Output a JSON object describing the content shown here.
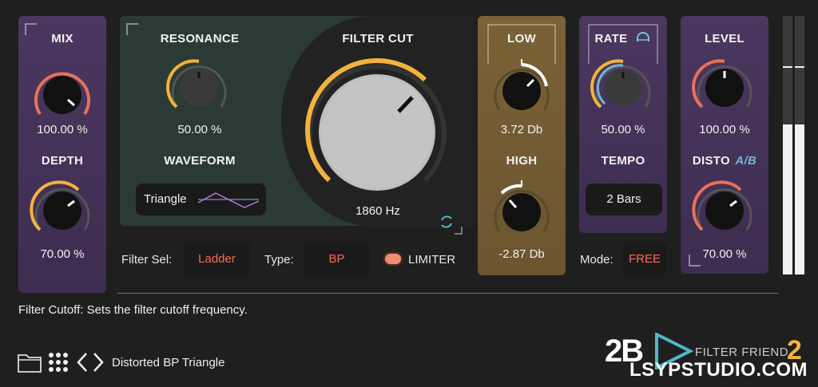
{
  "mix": {
    "label": "MIX",
    "value": "100.00 %",
    "level": 1.0
  },
  "depth": {
    "label": "DEPTH",
    "value": "70.00 %",
    "level": 0.7
  },
  "resonance": {
    "label": "RESONANCE",
    "value": "50.00 %",
    "level": 0.5
  },
  "waveform": {
    "label": "WAVEFORM",
    "selected": "Triangle"
  },
  "filter_cut": {
    "label": "FILTER CUT",
    "value": "1860 Hz"
  },
  "low": {
    "label": "LOW",
    "value": "3.72 Db"
  },
  "high": {
    "label": "HIGH",
    "value": "-2.87 Db"
  },
  "rate": {
    "label": "RATE",
    "value": "50.00 %"
  },
  "tempo": {
    "label": "TEMPO",
    "value": "2 Bars"
  },
  "level": {
    "label": "LEVEL",
    "value": "100.00 %"
  },
  "disto": {
    "label": "DISTO",
    "ab": "A/B",
    "value": "70.00 %"
  },
  "filter_bar": {
    "filter_sel_label": "Filter Sel:",
    "filter_sel_value": "Ladder",
    "type_label": "Type:",
    "type_value": "BP",
    "limiter_label": "LIMITER",
    "mode_label": "Mode:",
    "mode_value": "FREE"
  },
  "status": {
    "text": "Filter Cutoff: Sets the filter cutoff frequency."
  },
  "preset": {
    "name": "Distorted BP Triangle"
  },
  "brand": {
    "logo": "2B",
    "product": "FILTER FRIEND",
    "version": "2",
    "watermark": "LSYPSTUDIO.COM"
  },
  "colors": {
    "accent_orange": "#f2b33d",
    "accent_red": "#e8705a",
    "value_text": "#ff6a4d"
  }
}
